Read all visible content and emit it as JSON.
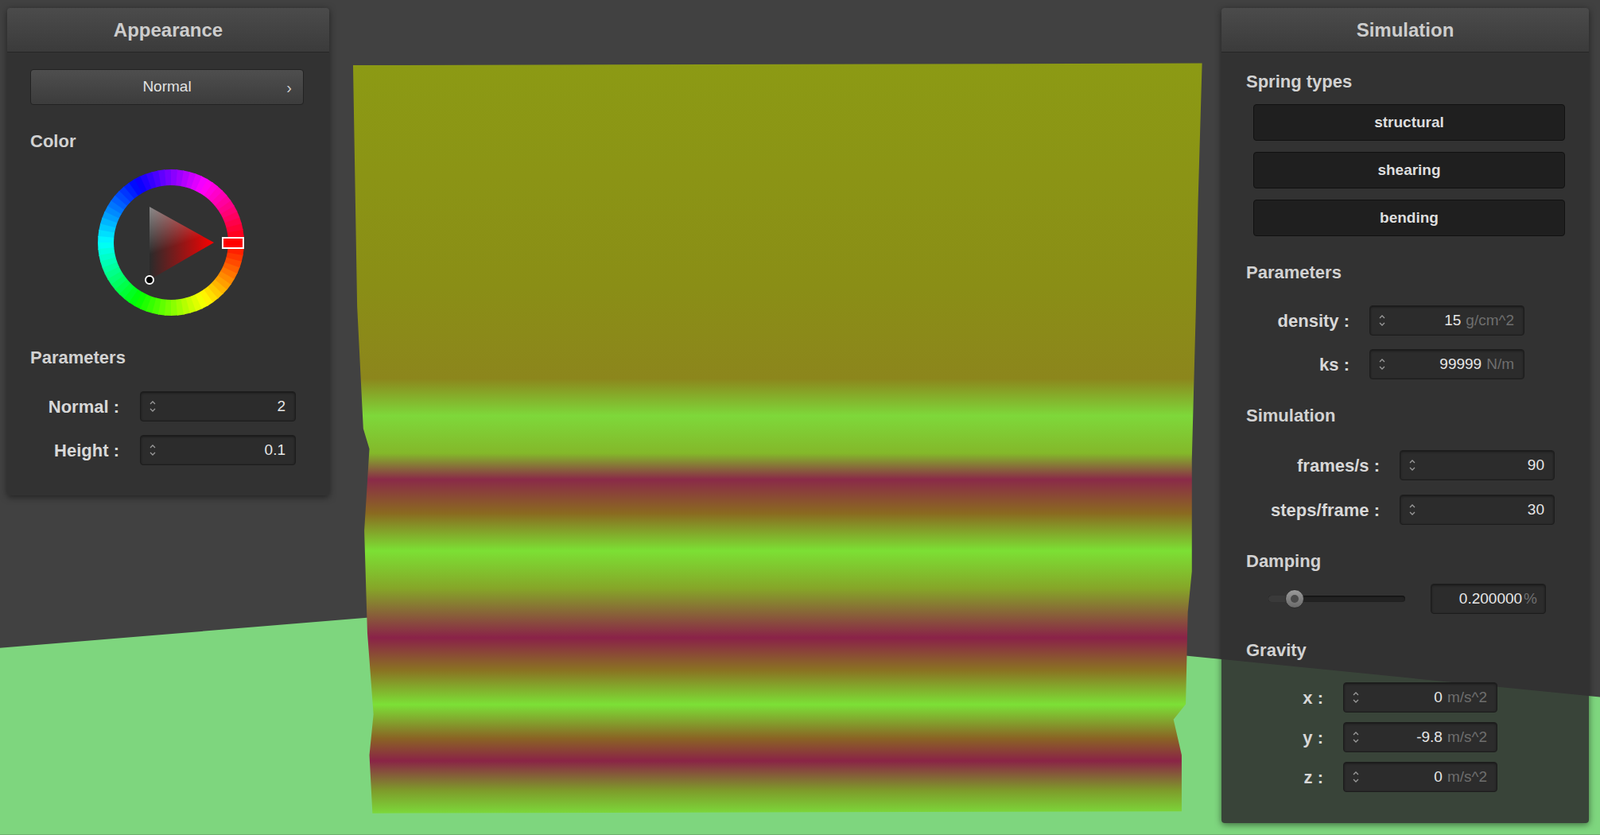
{
  "appearance": {
    "title": "Appearance",
    "shader": {
      "value": "Normal",
      "arrow": "›"
    },
    "color_label": "Color",
    "color_picker": {
      "hue": "#ff0000",
      "value": "#000000"
    },
    "parameters_label": "Parameters",
    "parameters": [
      {
        "label": "Normal :",
        "value": "2"
      },
      {
        "label": "Height :",
        "value": "0.1"
      }
    ]
  },
  "simulation": {
    "title": "Simulation",
    "spring_types_label": "Spring types",
    "spring_types": [
      {
        "label": "structural",
        "on": true
      },
      {
        "label": "shearing",
        "on": true
      },
      {
        "label": "bending",
        "on": true
      }
    ],
    "parameters_label": "Parameters",
    "parameters": [
      {
        "label": "density :",
        "value": "15",
        "unit": "g/cm^2"
      },
      {
        "label": "ks :",
        "value": "99999",
        "unit": "N/m"
      }
    ],
    "simulation_label": "Simulation",
    "simulation": [
      {
        "label": "frames/s :",
        "value": "90"
      },
      {
        "label": "steps/frame :",
        "value": "30"
      }
    ],
    "damping_label": "Damping",
    "damping": {
      "level": 0.19,
      "value": "0.200000",
      "unit": "%"
    },
    "gravity_label": "Gravity",
    "gravity": [
      {
        "label": "x :",
        "value": "0",
        "unit": "m/s^2"
      },
      {
        "label": "y :",
        "value": "-9.8",
        "unit": "m/s^2"
      },
      {
        "label": "z :",
        "value": "0",
        "unit": "m/s^2"
      }
    ]
  }
}
